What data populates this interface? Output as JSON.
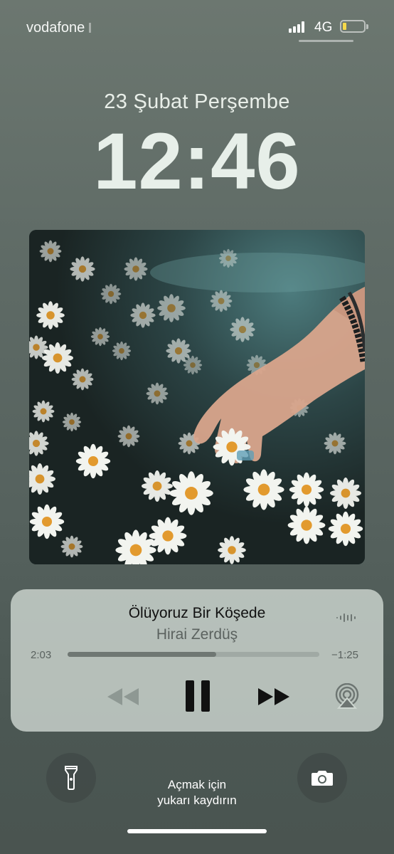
{
  "status_bar": {
    "carrier": "vodafone",
    "network": "4G",
    "signal_bars": 4,
    "battery_level": 0.15,
    "battery_color": "#f5d94a"
  },
  "lock_screen": {
    "date": "23 Şubat Perşembe",
    "time": "12:46"
  },
  "now_playing": {
    "title": "Ölüyoruz Bir Köşede",
    "artist": "Hirai Zerdüş",
    "elapsed": "2:03",
    "remaining": "−1:25",
    "progress": 0.59,
    "state": "playing",
    "icons": {
      "waveform": "waveform-icon",
      "rewind": "rewind-icon",
      "pause": "pause-icon",
      "forward": "fast-forward-icon",
      "airplay": "airplay-icon"
    },
    "artwork": "daisy-flowers-hand-photo"
  },
  "bottom": {
    "flashlight_icon": "flashlight-icon",
    "camera_icon": "camera-icon",
    "unlock_line1": "Açmak için",
    "unlock_line2": "yukarı kaydırın"
  }
}
